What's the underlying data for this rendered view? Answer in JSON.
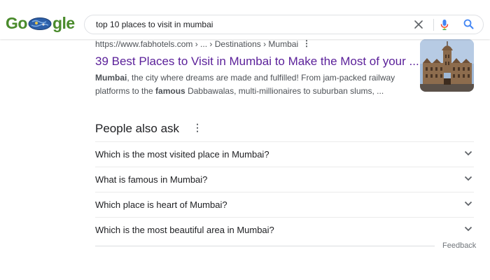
{
  "logo": {
    "text_start": "Go",
    "text_end": "gle"
  },
  "search": {
    "query": "top 10 places to visit in mumbai"
  },
  "result": {
    "cite": "https://www.fabhotels.com › ... › Destinations › Mumbai",
    "title": "39 Best Places to Visit in Mumbai to Make the Most of your ...",
    "snippet_bold1": "Mumbai",
    "snippet_part1": ", the city where dreams are made and fulfilled! From jam-packed railway platforms to the ",
    "snippet_bold2": "famous",
    "snippet_part2": " Dabbawalas, multi-millionaires to suburban slums, ..."
  },
  "paa": {
    "title": "People also ask",
    "questions": [
      "Which is the most visited place in Mumbai?",
      "What is famous in Mumbai?",
      "Which place is heart of Mumbai?",
      "Which is the most beautiful area in Mumbai?"
    ],
    "feedback": "Feedback"
  },
  "colors": {
    "title_link": "#5a1f99",
    "mic_blue": "#4285f4",
    "search_blue": "#4285f4"
  }
}
